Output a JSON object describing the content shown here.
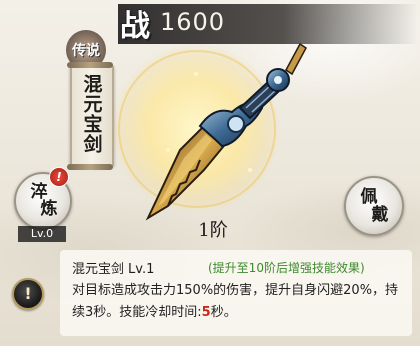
{
  "header": {
    "power_icon": "战",
    "power_value": "1600"
  },
  "weapon": {
    "rarity": "传说",
    "name": "混元宝剑",
    "stage": "1阶",
    "icon": "sword-icon",
    "glow_color": "#f5e08a"
  },
  "actions": {
    "refine": {
      "label_top": "淬",
      "label_bottom": "炼",
      "level": "Lv.0",
      "badge": "!"
    },
    "equip": {
      "label_top": "佩",
      "label_bottom": "戴"
    }
  },
  "skill": {
    "name": "混元宝剑",
    "level": "Lv.1",
    "hint": "(提升至10阶后增强技能效果)",
    "desc_part1": "对目标造成攻击力150%的伤害，提升自身闪避20%，持续3秒。技能冷却时间:",
    "cooldown": "5",
    "desc_part2": "秒。",
    "info_icon": "!"
  },
  "colors": {
    "hint": "#3f8a2e",
    "highlight": "#c9281e"
  }
}
